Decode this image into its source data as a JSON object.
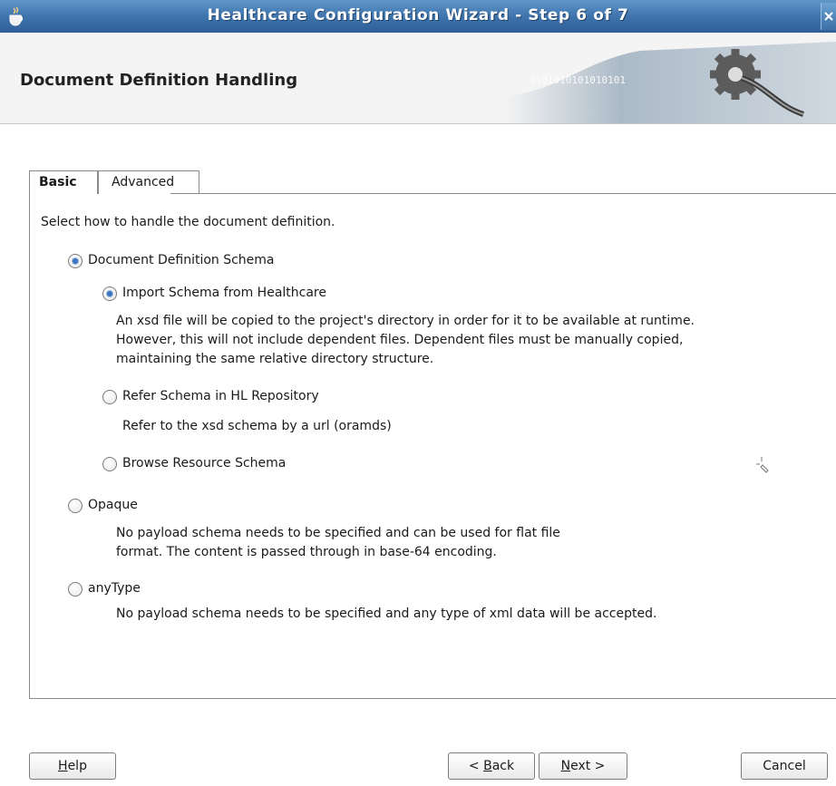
{
  "window": {
    "title": "Healthcare Configuration Wizard - Step 6 of 7",
    "app_icon": "java-cup-icon",
    "close_icon": "close-icon"
  },
  "header": {
    "title": "Document Definition Handling",
    "art_text": "0101010101010101"
  },
  "tabs": [
    {
      "label": "Basic",
      "selected": true
    },
    {
      "label": "Advanced",
      "selected": false
    }
  ],
  "main": {
    "instruction": "Select how to handle the document definition.",
    "options": {
      "document_definition_schema": {
        "label": "Document Definition Schema",
        "selected": true
      },
      "import_schema": {
        "label": "Import Schema from Healthcare",
        "selected": true,
        "desc": [
          "An xsd file will be copied to the project's directory in order for it to be available at runtime.",
          "However, this will not include dependent files.  Dependent files must be manually copied,",
          "maintaining the same relative directory structure."
        ]
      },
      "refer_schema": {
        "label": "Refer Schema in HL Repository",
        "selected": false,
        "desc": "Refer to the xsd schema by a url (oramds)"
      },
      "browse_schema": {
        "label": "Browse Resource Schema",
        "selected": false
      },
      "opaque": {
        "label": "Opaque",
        "selected": false,
        "desc": [
          "No payload schema needs to be specified and can be used for flat file",
          "format. The content is passed through in base-64 encoding."
        ]
      },
      "anytype": {
        "label": "anyType",
        "selected": false,
        "desc": "No payload schema needs to be specified and any type of xml data will be accepted."
      }
    }
  },
  "buttons": {
    "help": {
      "mnemonic": "H",
      "rest": "elp"
    },
    "back": {
      "prefix": "< ",
      "mnemonic": "B",
      "rest": "ack"
    },
    "next": {
      "mnemonic": "N",
      "rest": "ext >"
    },
    "cancel": "Cancel"
  },
  "colors": {
    "titlebar": "#3f74ad",
    "radio_selected": "#3b74c0"
  }
}
